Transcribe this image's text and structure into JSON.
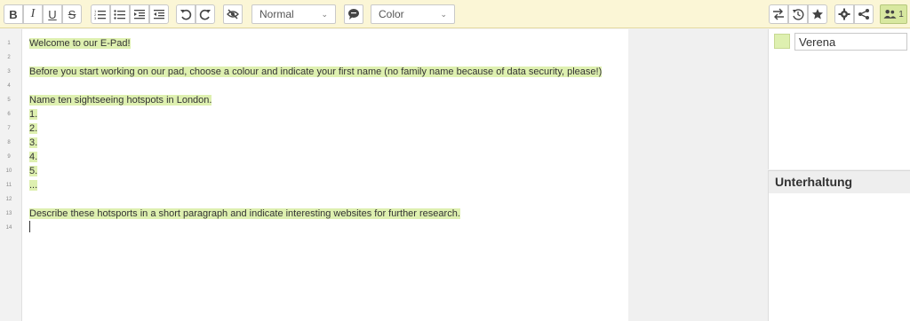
{
  "toolbar": {
    "bold_label": "B",
    "italic_label": "I",
    "underline_label": "U",
    "strike_label": "S",
    "format_select": "Normal",
    "color_select": "Color",
    "users_count": "1",
    "icons": [
      "bold-icon",
      "italic-icon",
      "underline-icon",
      "strikethrough-icon",
      "ordered-list-icon",
      "unordered-list-icon",
      "indent-icon",
      "outdent-icon",
      "undo-icon",
      "redo-icon",
      "clear-authorship-icon",
      "comment-icon",
      "import-export-icon",
      "timeslider-icon",
      "star-icon",
      "gear-icon",
      "share-icon",
      "users-icon"
    ]
  },
  "editor": {
    "line_numbers": [
      "1",
      "2",
      "3",
      "4",
      "5",
      "6",
      "7",
      "8",
      "9",
      "10",
      "11",
      "12",
      "13",
      "14"
    ],
    "lines": [
      "Welcome to our E-Pad!",
      "",
      "Before you start working on our pad, choose a colour and  indicate your first name (no family name because of data security, please!)",
      "",
      "Name ten sightseeing hotspots in London.",
      "1.",
      "2.",
      "3.",
      "4.",
      "5.",
      "...",
      "",
      "Describe these hotsports in a short paragraph and indicate interesting websites for further research.",
      ""
    ]
  },
  "users_panel": {
    "user_name": "Verena",
    "user_color": "#def0b0"
  },
  "chat": {
    "title": "Unterhaltung"
  }
}
